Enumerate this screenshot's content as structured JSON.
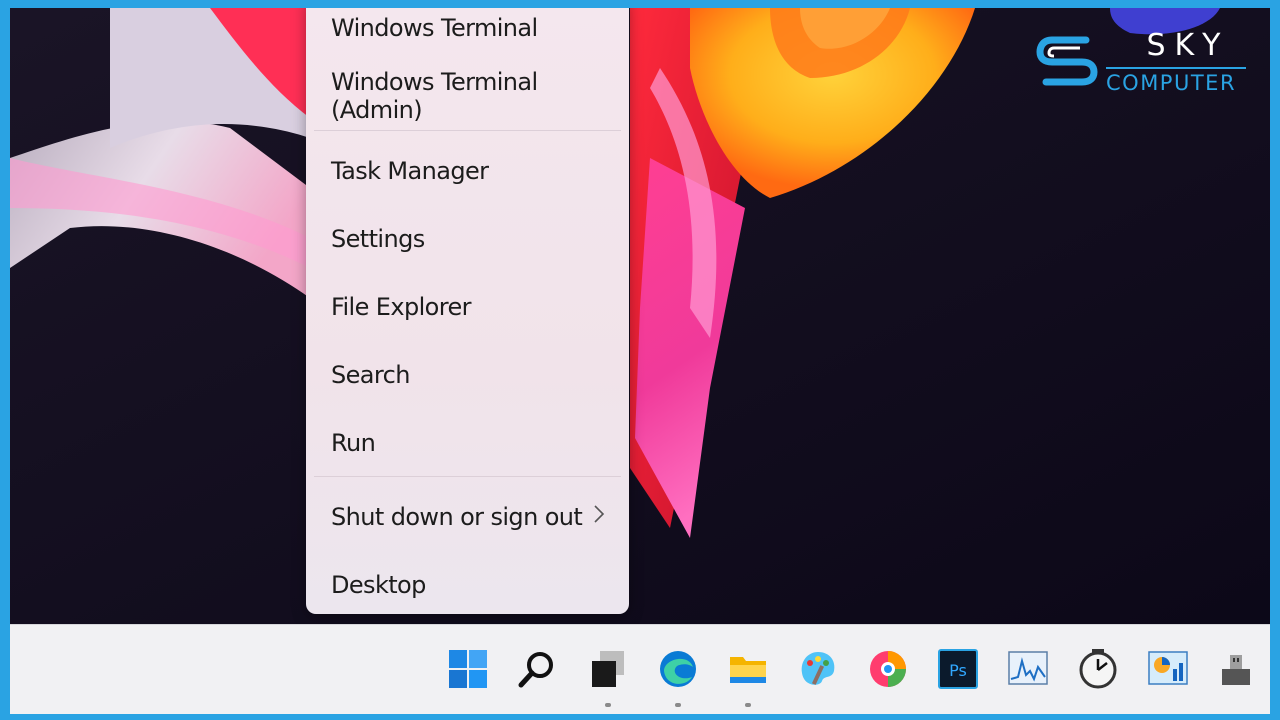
{
  "menu": {
    "items": [
      {
        "label": "Windows Terminal"
      },
      {
        "label": "Windows Terminal (Admin)"
      },
      {
        "label": "Task Manager"
      },
      {
        "label": "Settings"
      },
      {
        "label": "File Explorer"
      },
      {
        "label": "Search"
      },
      {
        "label": "Run"
      },
      {
        "label": "Shut down or sign out",
        "submenu_icon": "chevron-right-icon"
      },
      {
        "label": "Desktop"
      }
    ]
  },
  "taskbar": {
    "icons": [
      "start-icon",
      "search-icon",
      "task-view-icon",
      "edge-icon",
      "file-explorer-icon",
      "paint-icon",
      "edge-dev-icon",
      "photoshop-icon",
      "resource-monitor-icon",
      "clock-icon",
      "performance-icon",
      "usb-icon"
    ],
    "photoshop_label": "Ps"
  },
  "logo": {
    "brand": "SKY",
    "sub": "COMPUTER",
    "color": "#2aa3e3"
  },
  "colors": {
    "border": "#2aa3e3",
    "menu_bg": "#f3e6ed",
    "taskbar_bg": "#f1f1f3",
    "desktop_bg": "#0e0a1e"
  }
}
